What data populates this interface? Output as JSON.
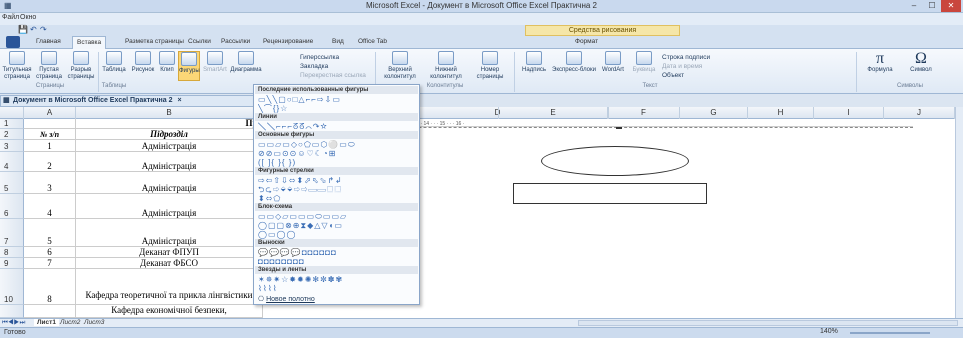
{
  "window": {
    "title": "Microsoft Excel - Документ в Microsoft Office Excel Практична 2",
    "min": "–",
    "max": "☐",
    "close": "✕"
  },
  "menu": {
    "file": "Файл",
    "window": "Окно"
  },
  "ribbon": {
    "context_band": "Средства рисования",
    "tabs": [
      "Главная",
      "Вставка",
      "Разметка страницы",
      "Ссылки",
      "Рассылки",
      "Рецензирование",
      "Вид",
      "Office Tab",
      "Формат"
    ],
    "active_tab": "Вставка",
    "buttons": [
      "Титульная страница",
      "Пустая страница",
      "Разрыв страницы",
      "Таблица",
      "Рисунок",
      "Клип",
      "Фигуры",
      "SmartArt",
      "Диаграмма"
    ],
    "links": [
      "Гиперссылка",
      "Закладка",
      "Перекрестная ссылка"
    ],
    "header_footer": [
      "Верхний колонтитул",
      "Нижний колонтитул",
      "Номер страницы"
    ],
    "text_buttons": [
      "Надпись",
      "Экспресс-блоки",
      "WordArt",
      "Буквица"
    ],
    "text_small": [
      "Строка подписи",
      "Дата и время",
      "Объект"
    ],
    "symbols": [
      "Формула",
      "Символ"
    ],
    "groups": [
      "Страницы",
      "Таблицы",
      "Колонтитулы",
      "Текст",
      "Символы"
    ]
  },
  "doc_tab": "Документ в Microsoft Office Excel Практична 2",
  "columns": [
    "A",
    "B",
    "C",
    "D",
    "E",
    "F",
    "G",
    "H",
    "I",
    "J"
  ],
  "ruler": "· 5 · · · 4 · · · 5 · · · 6 · · · 7 · · · 8 · · · 9 · · · 10 · · · 11 · · · 12 · · · 13 · · · 14 · · · 15 · · · 16 ·",
  "rows": [
    {
      "n": "1",
      "a": "",
      "b": "Пра"
    },
    {
      "n": "2",
      "a": "№ з/п",
      "b": "Підрозділ"
    },
    {
      "n": "3",
      "a": "1",
      "b": "Адміністрація"
    },
    {
      "n": "4",
      "a": "2",
      "b": "Адміністрація"
    },
    {
      "n": "5",
      "a": "3",
      "b": "Адміністрація"
    },
    {
      "n": "6",
      "a": "4",
      "b": "Адміністрація"
    },
    {
      "n": "7",
      "a": "5",
      "b": "Адміністрація"
    },
    {
      "n": "8",
      "a": "6",
      "b": "Деканат ФПУП"
    },
    {
      "n": "9",
      "a": "7",
      "b": "Деканат ФБСО"
    },
    {
      "n": "10",
      "a": "8",
      "b": "Кафедра теоретичної та прикла лінгвістики"
    },
    {
      "n": "",
      "a": "",
      "b": "Кафедра економічної безпеки,"
    }
  ],
  "dropdown": {
    "headers": [
      "Последние использованные фигуры",
      "Линии",
      "Основные фигуры",
      "Фигурные стрелки",
      "Блок-схема",
      "Выноски",
      "Звезды и ленты"
    ],
    "rows": [
      "▭╲╲▢○□△⌐⌐⇨⇩▭",
      "╲⌒{}☆",
      "╲╲⌐⌐⌐ᘔᘔ⌒↷☆",
      "▭▭▱▭◇○⬠▭⬡⚪▭⬭",
      "⊘⊘▭⊙⊙☺♡☾◔⊞",
      "([ ]{ }{ })",
      "⇨⇦⇧⇩⬄⬍⬀⬁⬂↱↲",
      "⮌⮎⇨⬙⬙⇨⇨▭▭⬚⬚",
      "⬍⬄⬠",
      "▭▭◇▱▭▭▭⬭▭▭▱",
      "◯▢▢⊗⊕⧗◆△▽◖▭",
      "◯▭◯◯",
      "💬💬💬💬◘◘◘◘◘◘",
      "◘◘◘◘◘◘◘◘",
      "✶✵✷☆✸✹✺✻✼✽✾",
      "⌇⌇⌇⌇"
    ],
    "new_canvas": "Новое полотно"
  },
  "sheets": [
    "Лист1",
    "Лист2",
    "Лист3"
  ],
  "status": {
    "ready": "Готово",
    "zoom": "140%"
  }
}
